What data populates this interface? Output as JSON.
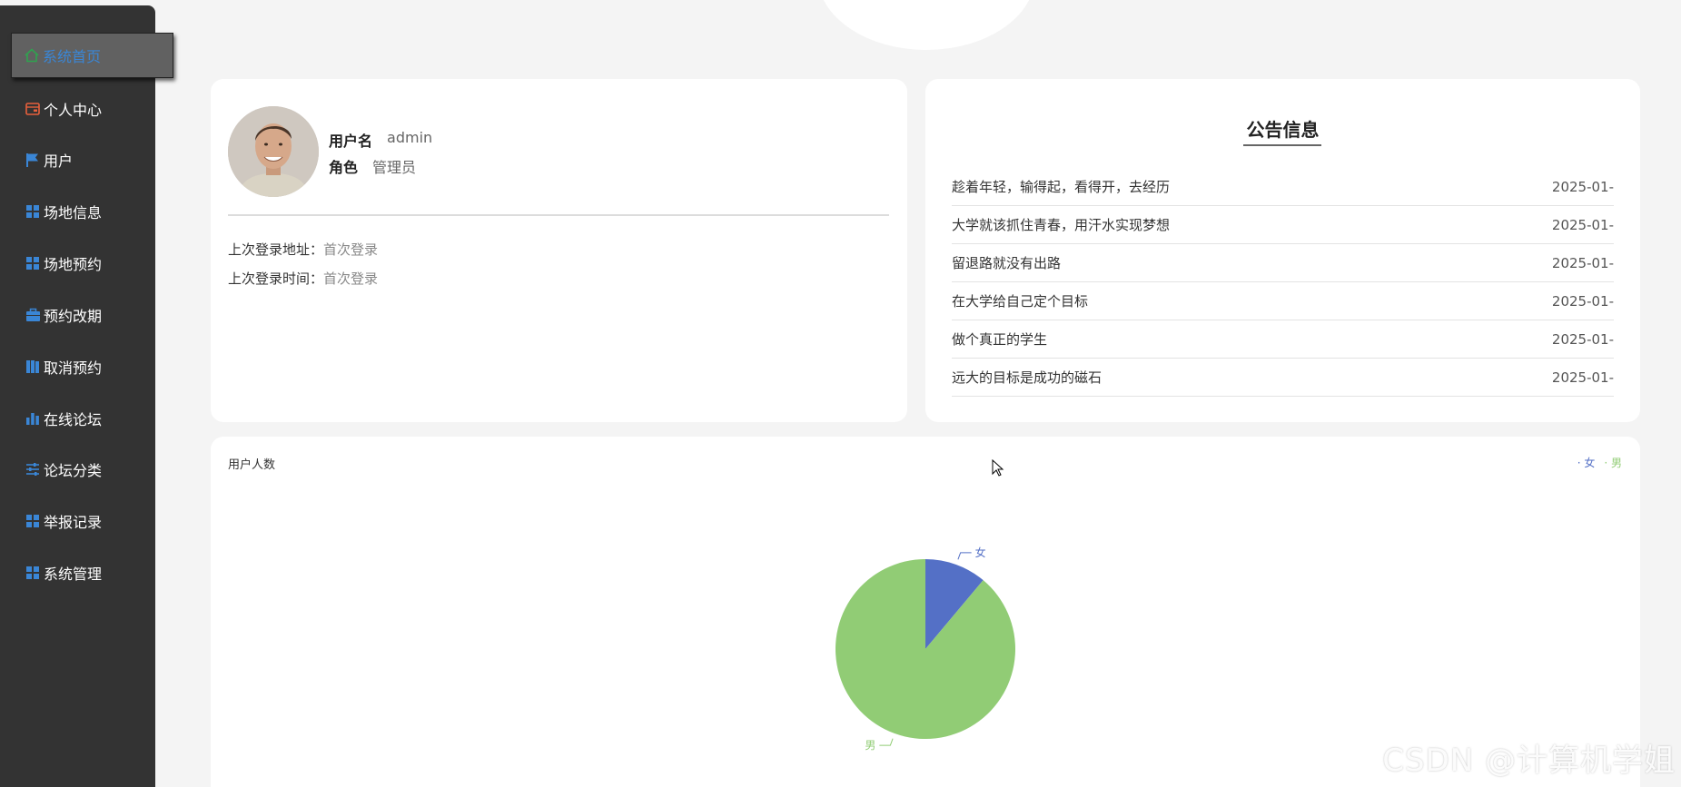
{
  "sidebar": {
    "items": [
      {
        "label": "系统首页",
        "icon": "home-icon"
      },
      {
        "label": "个人中心",
        "icon": "wallet-icon"
      },
      {
        "label": "用户",
        "icon": "flag-icon"
      },
      {
        "label": "场地信息",
        "icon": "grid-icon"
      },
      {
        "label": "场地预约",
        "icon": "grid-icon"
      },
      {
        "label": "预约改期",
        "icon": "briefcase-icon"
      },
      {
        "label": "取消预约",
        "icon": "books-icon"
      },
      {
        "label": "在线论坛",
        "icon": "bar-chart-icon"
      },
      {
        "label": "论坛分类",
        "icon": "sliders-icon"
      },
      {
        "label": "举报记录",
        "icon": "grid-icon"
      },
      {
        "label": "系统管理",
        "icon": "grid-icon"
      }
    ],
    "active_color": "#3a86d6",
    "bg_color": "#333333"
  },
  "user": {
    "username_label": "用户名",
    "username": "admin",
    "role_label": "角色",
    "role": "管理员",
    "last_addr_label": "上次登录地址：",
    "last_addr": "首次登录",
    "last_time_label": "上次登录时间：",
    "last_time": "首次登录"
  },
  "notice": {
    "title": "公告信息",
    "items": [
      {
        "text": "趁着年轻，输得起，看得开，去经历",
        "date": "2025-01-"
      },
      {
        "text": "大学就该抓住青春，用汗水实现梦想",
        "date": "2025-01-"
      },
      {
        "text": "留退路就没有出路",
        "date": "2025-01-"
      },
      {
        "text": "在大学给自己定个目标",
        "date": "2025-01-"
      },
      {
        "text": "做个真正的学生",
        "date": "2025-01-"
      },
      {
        "text": "远大的目标是成功的磁石",
        "date": "2025-01-"
      }
    ]
  },
  "chart_data": {
    "type": "pie",
    "title": "用户人数",
    "legend": [
      "女",
      "男"
    ],
    "legend_position": "top-right",
    "series": [
      {
        "name": "女",
        "value": 1,
        "color": "#5470c6"
      },
      {
        "name": "男",
        "value": 8,
        "color": "#91cc75"
      }
    ]
  },
  "watermark": "CSDN @计算机学姐"
}
